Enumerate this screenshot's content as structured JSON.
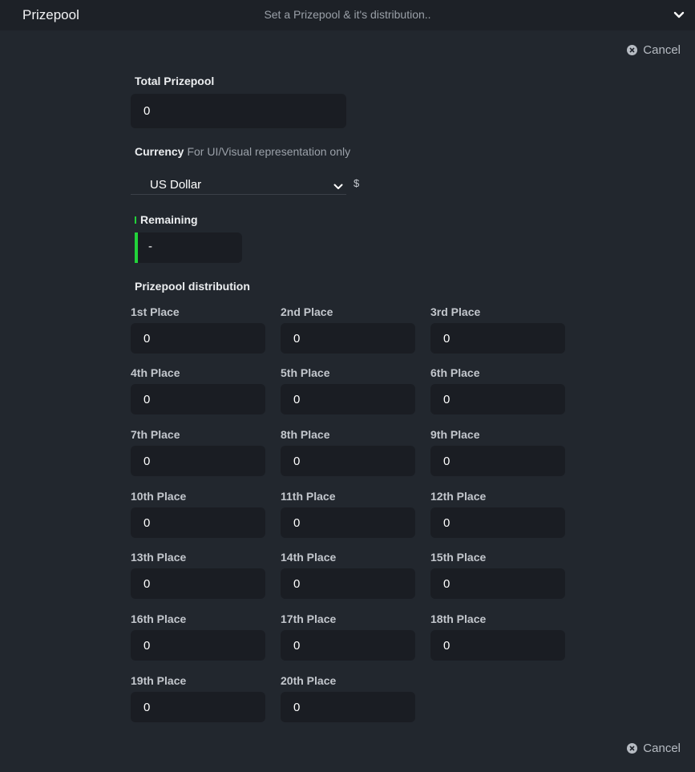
{
  "header": {
    "title": "Prizepool",
    "subtitle": "Set a Prizepool & it's distribution.."
  },
  "cancel_label": "Cancel",
  "total": {
    "label": "Total Prizepool",
    "value": "0"
  },
  "currency": {
    "label": "Currency",
    "hint": "For UI/Visual representation only",
    "selected": "US Dollar",
    "symbol": "$"
  },
  "remaining": {
    "label": "Remaining",
    "value": "-",
    "accent": "#22d33a"
  },
  "distribution": {
    "label": "Prizepool distribution",
    "places": [
      {
        "label": "1st Place",
        "value": "0"
      },
      {
        "label": "2nd Place",
        "value": "0"
      },
      {
        "label": "3rd Place",
        "value": "0"
      },
      {
        "label": "4th Place",
        "value": "0"
      },
      {
        "label": "5th Place",
        "value": "0"
      },
      {
        "label": "6th Place",
        "value": "0"
      },
      {
        "label": "7th Place",
        "value": "0"
      },
      {
        "label": "8th Place",
        "value": "0"
      },
      {
        "label": "9th Place",
        "value": "0"
      },
      {
        "label": "10th Place",
        "value": "0"
      },
      {
        "label": "11th Place",
        "value": "0"
      },
      {
        "label": "12th Place",
        "value": "0"
      },
      {
        "label": "13th Place",
        "value": "0"
      },
      {
        "label": "14th Place",
        "value": "0"
      },
      {
        "label": "15th Place",
        "value": "0"
      },
      {
        "label": "16th Place",
        "value": "0"
      },
      {
        "label": "17th Place",
        "value": "0"
      },
      {
        "label": "18th Place",
        "value": "0"
      },
      {
        "label": "19th Place",
        "value": "0"
      },
      {
        "label": "20th Place",
        "value": "0"
      }
    ]
  }
}
